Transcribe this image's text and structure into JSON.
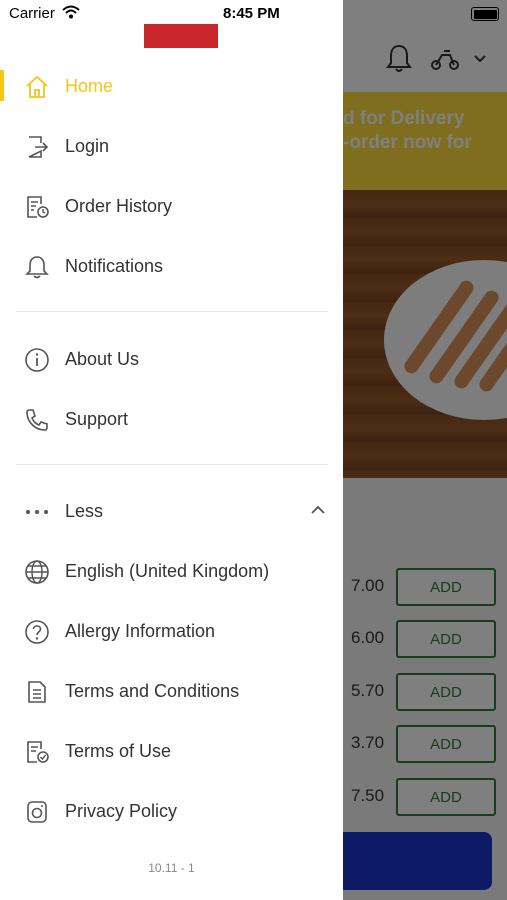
{
  "status_bar": {
    "carrier": "Carrier",
    "time": "8:45 PM"
  },
  "background": {
    "banner_lines": [
      "d for Delivery",
      "-order now for"
    ],
    "menu_rows": [
      {
        "price": "7.00",
        "button": "ADD"
      },
      {
        "price": "6.00",
        "button": "ADD"
      },
      {
        "price": "5.70",
        "button": "ADD"
      },
      {
        "price": "3.70",
        "button": "ADD"
      },
      {
        "price": "7.50",
        "button": "ADD"
      }
    ]
  },
  "drawer": {
    "items_top": [
      {
        "label": "Home",
        "icon": "home-icon",
        "active": true
      },
      {
        "label": "Login",
        "icon": "login-icon"
      },
      {
        "label": "Order History",
        "icon": "order-history-icon"
      },
      {
        "label": "Notifications",
        "icon": "bell-icon"
      }
    ],
    "items_mid": [
      {
        "label": "About Us",
        "icon": "info-icon"
      },
      {
        "label": "Support",
        "icon": "phone-icon"
      }
    ],
    "less_label": "Less",
    "items_bottom": [
      {
        "label": "English (United Kingdom)",
        "icon": "globe-icon"
      },
      {
        "label": "Allergy Information",
        "icon": "question-icon"
      },
      {
        "label": "Terms and Conditions",
        "icon": "document-icon"
      },
      {
        "label": "Terms of Use",
        "icon": "document-check-icon"
      },
      {
        "label": "Privacy Policy",
        "icon": "privacy-icon"
      }
    ],
    "version": "10.11 - 1"
  },
  "colors": {
    "accent": "#f5c518",
    "banner": "#ffdd3c",
    "add_button": "#2f7a3a",
    "checkout": "#1a35cc",
    "logo": "#c8262b"
  }
}
